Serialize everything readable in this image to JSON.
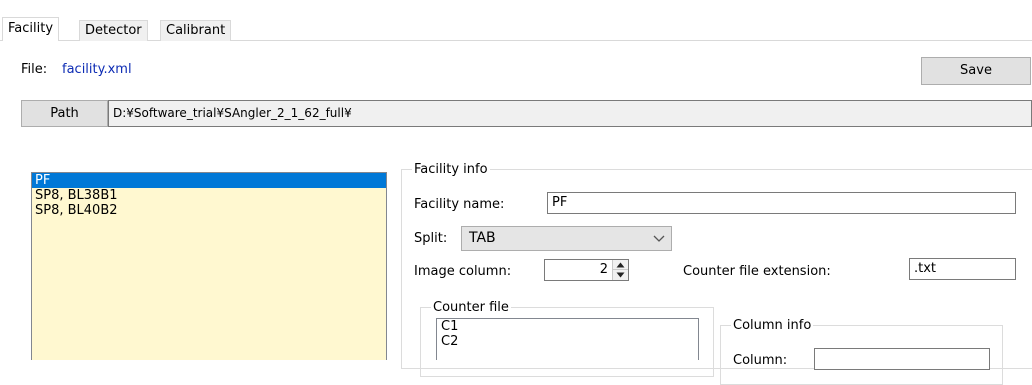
{
  "tabs": [
    {
      "label": "Facility",
      "active": true
    },
    {
      "label": "Detector",
      "active": false
    },
    {
      "label": "Calibrant",
      "active": false
    }
  ],
  "file": {
    "label": "File:",
    "value": "facility.xml"
  },
  "save_label": "Save",
  "path": {
    "button_label": "Path",
    "value": "D:¥Software_trial¥SAngler_2_1_62_full¥"
  },
  "facilities": {
    "items": [
      "PF",
      "SP8, BL38B1",
      "SP8, BL40B2"
    ],
    "selected": "PF"
  },
  "facility_info": {
    "legend": "Facility info",
    "name_label": "Facility name:",
    "name_value": "PF",
    "split_label": "Split:",
    "split_value": "TAB",
    "image_column_label": "Image column:",
    "image_column_value": "2",
    "counter_ext_label": "Counter file extension:",
    "counter_ext_value": ".txt"
  },
  "counter_file": {
    "legend": "Counter file",
    "items": [
      "C1",
      "C2"
    ]
  },
  "column_info": {
    "legend": "Column info",
    "column_label": "Column:",
    "column_value": ""
  },
  "colors": {
    "selection": "#0078d7",
    "list_background": "#fff8d0",
    "file_link": "#0d2cb4"
  }
}
